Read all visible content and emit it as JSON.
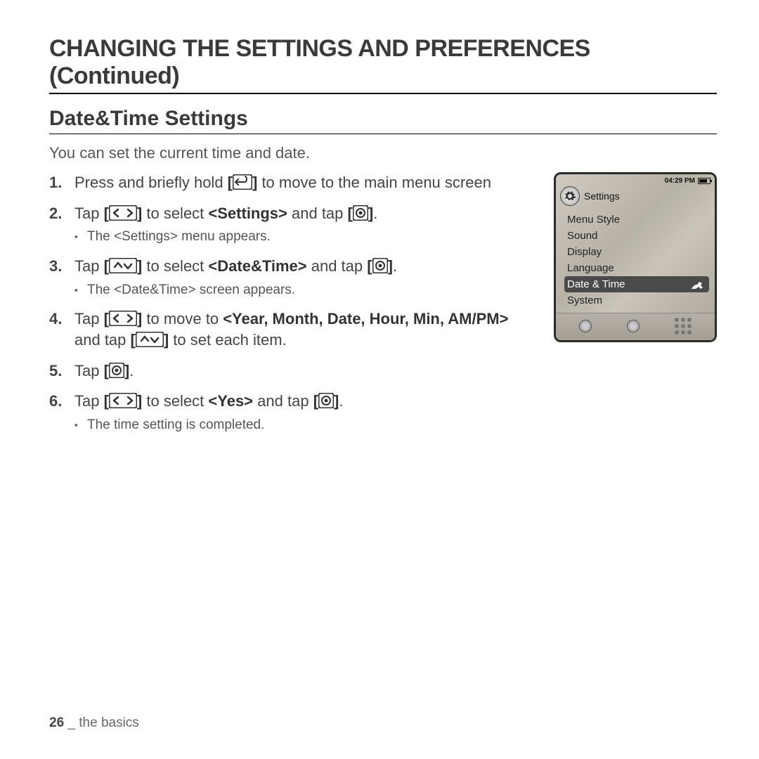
{
  "page": {
    "title": "CHANGING THE SETTINGS AND PREFERENCES (Continued)",
    "section": "Date&Time Settings",
    "intro": "You can set the current time and date."
  },
  "steps": [
    {
      "pre": "Press and briefly hold ",
      "icon": "back",
      "post": " to move to the main menu screen"
    },
    {
      "pre": "Tap ",
      "icon": "lr",
      "mid": " to select ",
      "bold": "<Settings>",
      "post2": " and tap ",
      "icon2": "ok",
      "tail": ".",
      "sub": "The <Settings> menu appears."
    },
    {
      "pre": "Tap ",
      "icon": "ud",
      "mid": " to select ",
      "bold": "<Date&Time>",
      "post2": " and tap ",
      "icon2": "ok",
      "tail": ".",
      "sub": "The <Date&Time> screen appears."
    },
    {
      "pre": "Tap ",
      "icon": "lr",
      "mid": " to move to ",
      "bold": "<Year, Month, Date, Hour, Min, AM/PM>",
      "post2": " and tap ",
      "icon2": "ud",
      "tail": " to set each item."
    },
    {
      "pre": "Tap ",
      "icon": "ok",
      "tail": "."
    },
    {
      "pre": "Tap ",
      "icon": "lr",
      "mid": " to select ",
      "bold": "<Yes>",
      "post2": " and tap ",
      "icon2": "ok",
      "tail": ".",
      "sub": "The time setting is completed."
    }
  ],
  "device": {
    "time": "04:29 PM",
    "headerLabel": "Settings",
    "menu": [
      "Menu Style",
      "Sound",
      "Display",
      "Language",
      "Date & Time",
      "System"
    ],
    "selectedIndex": 4
  },
  "footer": {
    "page": "26",
    "sep": " _ ",
    "chapter": "the basics"
  }
}
